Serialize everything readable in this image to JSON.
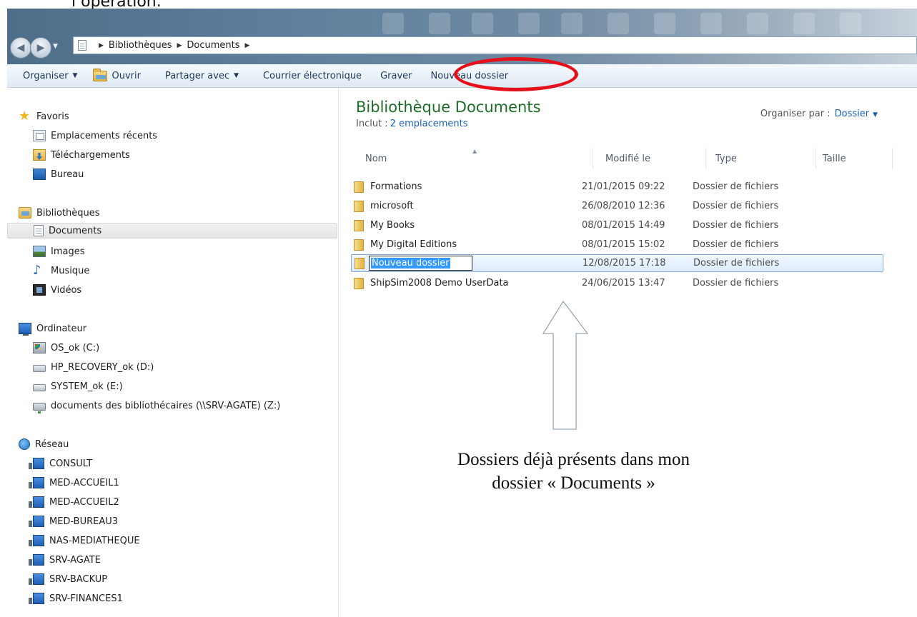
{
  "caption_top": "l’opération.",
  "address_bar": {
    "breadcrumbs": [
      "Bibliothèques",
      "Documents"
    ]
  },
  "toolbar": {
    "organize": "Organiser",
    "open": "Ouvrir",
    "share": "Partager avec",
    "email": "Courrier électronique",
    "burn": "Graver",
    "new_folder": "Nouveau dossier"
  },
  "nav_pane": {
    "favorites": {
      "label": "Favoris",
      "items": [
        "Emplacements récents",
        "Téléchargements",
        "Bureau"
      ]
    },
    "libraries": {
      "label": "Bibliothèques",
      "items": [
        "Documents",
        "Images",
        "Musique",
        "Vidéos"
      ],
      "selected": "Documents"
    },
    "computer": {
      "label": "Ordinateur",
      "items": [
        "OS_ok (C:)",
        "HP_RECOVERY_ok (D:)",
        "SYSTEM_ok (E:)",
        "documents des bibliothécaires (\\\\SRV-AGATE) (Z:)"
      ]
    },
    "network": {
      "label": "Réseau",
      "items": [
        "CONSULT",
        "MED-ACCUEIL1",
        "MED-ACCUEIL2",
        "MED-BUREAU3",
        "NAS-MEDIATHEQUE",
        "SRV-AGATE",
        "SRV-BACKUP",
        "SRV-FINANCES1"
      ]
    }
  },
  "content": {
    "title": "Bibliothèque Documents",
    "includes_label": "Inclut :",
    "includes_link": "2 emplacements",
    "arrange_label": "Organiser par :",
    "arrange_value": "Dossier",
    "columns": [
      "Nom",
      "Modifié le",
      "Type",
      "Taille"
    ],
    "rows": [
      {
        "name": "Formations",
        "modified": "21/01/2015 09:22",
        "type": "Dossier de fichiers"
      },
      {
        "name": "microsoft",
        "modified": "26/08/2010 12:36",
        "type": "Dossier de fichiers"
      },
      {
        "name": "My Books",
        "modified": "08/01/2015 14:49",
        "type": "Dossier de fichiers"
      },
      {
        "name": "My Digital Editions",
        "modified": "08/01/2015 15:02",
        "type": "Dossier de fichiers"
      },
      {
        "name": "Nouveau dossier",
        "modified": "12/08/2015 17:18",
        "type": "Dossier de fichiers",
        "selected": true,
        "renaming": true
      },
      {
        "name": "ShipSim2008 Demo UserData",
        "modified": "24/06/2015 13:47",
        "type": "Dossier de fichiers"
      }
    ]
  },
  "annotation": {
    "line1": "Dossiers déjà présents dans mon",
    "line2": "dossier  « Documents »"
  },
  "colors": {
    "highlight_ring": "#e6101a",
    "title_green": "#1e6d27",
    "link_blue": "#1a63b8",
    "selection_blue": "#3399ff"
  }
}
